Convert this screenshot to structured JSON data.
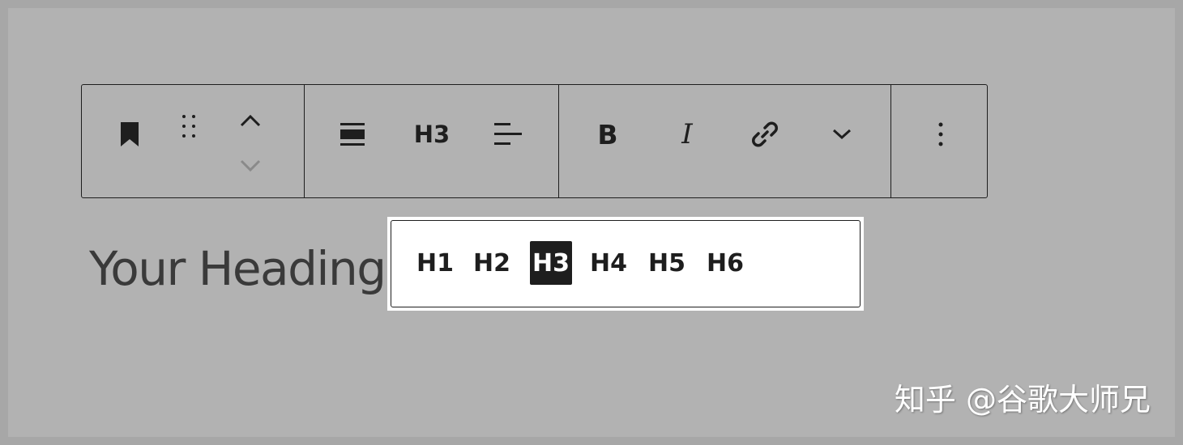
{
  "toolbar": {
    "block_icon": "bookmark-icon",
    "drag_icon": "drag-handle-icon",
    "move_up_icon": "chevron-up-icon",
    "move_down_icon": "chevron-down-icon",
    "align_icon": "align-center-icon",
    "heading_level_label": "H3",
    "text_align_icon": "align-left-icon",
    "bold_label": "B",
    "italic_label": "I",
    "link_icon": "link-icon",
    "more_formats_icon": "chevron-down-icon",
    "options_icon": "more-vertical-icon"
  },
  "content": {
    "heading_text": "Your Heading"
  },
  "heading_levels": {
    "items": [
      "H1",
      "H2",
      "H3",
      "H4",
      "H5",
      "H6"
    ],
    "selected": "H3"
  },
  "watermark": {
    "text": "知乎 @谷歌大师兄"
  },
  "colors": {
    "background": "#b2b2b2",
    "foreground": "#1e1e1e",
    "popover_bg": "#ffffff",
    "disabled": "#8a8a8a"
  }
}
